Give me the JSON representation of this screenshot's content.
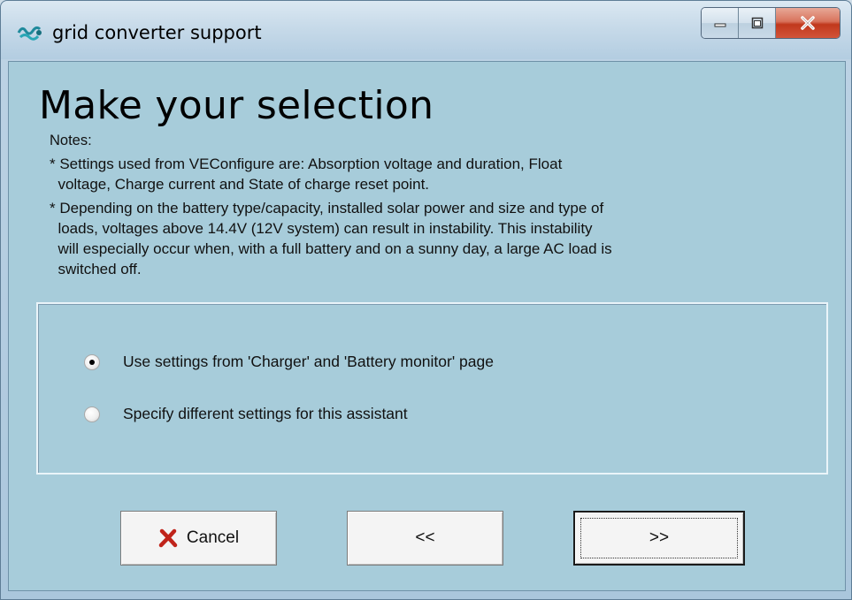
{
  "window": {
    "title": "grid converter support",
    "icon": "victron-app-icon",
    "controls": [
      "minimize-icon",
      "maximize-icon",
      "close-icon"
    ]
  },
  "page": {
    "heading": "Make your selection",
    "notes_label": "Notes:",
    "notes": [
      "* Settings used from VEConfigure are: Absorption voltage and duration, Float\n  voltage, Charge current and State of charge reset point.",
      "* Depending on the battery type/capacity, installed solar power and size and type of\n  loads, voltages above 14.4V (12V system) can result in instability. This instability\n  will especially occur when, with a full battery and on a sunny day, a large AC load is\n  switched off."
    ]
  },
  "options": [
    {
      "label": "Use settings from 'Charger' and 'Battery monitor' page",
      "selected": true
    },
    {
      "label": "Specify different settings for this assistant",
      "selected": false
    }
  ],
  "buttons": {
    "cancel": "Cancel",
    "back": "<<",
    "next": ">>"
  },
  "colors": {
    "panel_background": "#a7ccda",
    "cancel_icon": "#c0241b"
  }
}
